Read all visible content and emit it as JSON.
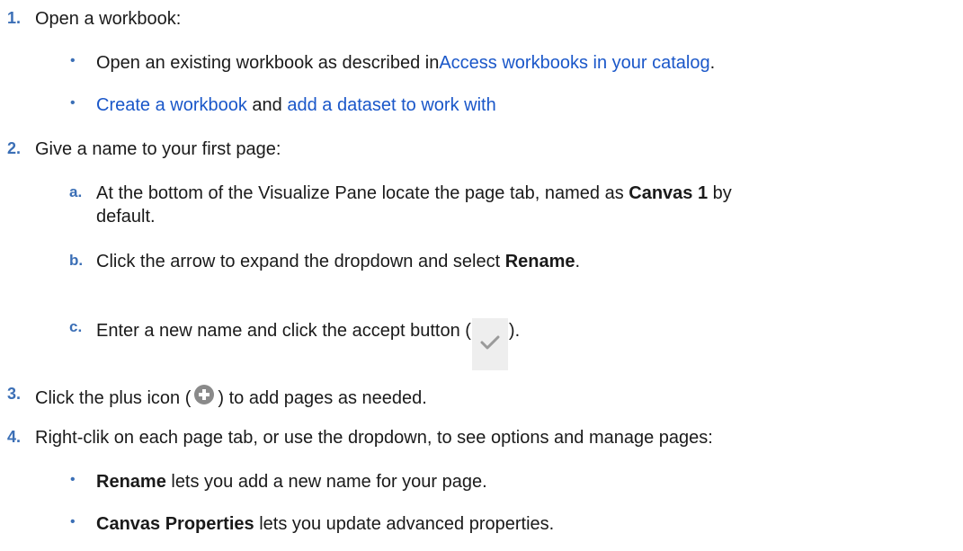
{
  "steps": [
    {
      "num": "1.",
      "text": "Open a workbook:",
      "bullets": [
        {
          "pre": "Open an existing workbook as described in",
          "link": "Access workbooks in your catalog",
          "post": "."
        },
        {
          "link1": "Create a workbook",
          "mid": " and ",
          "link2": "add a dataset to work with"
        }
      ]
    },
    {
      "num": "2.",
      "text": "Give a name to your first page:",
      "subs": [
        {
          "letter": "a.",
          "pre": "At the bottom of the Visualize Pane locate the page tab, named as ",
          "bold": "Canvas 1",
          "post": " by",
          "line2": "default."
        },
        {
          "letter": "b.",
          "pre": "Click the arrow to expand the dropdown and select ",
          "bold": "Rename",
          "post": "."
        },
        {
          "letter": "c.",
          "pre": "Enter a new name and click the accept button (",
          "post": ")."
        }
      ]
    },
    {
      "num": "3.",
      "pre": "Click the plus icon (",
      "post": ") to add pages as needed."
    },
    {
      "num": "4.",
      "text": "Right-clik on each page tab, or use the dropdown, to see options and manage pages:",
      "bullets": [
        {
          "bold": "Rename",
          "rest": " lets you add a new name for your page."
        },
        {
          "bold": "Canvas Properties",
          "rest": " lets you update advanced properties."
        }
      ]
    }
  ],
  "bullet_char": "•",
  "colors": {
    "accent": "#3b6fb6",
    "link": "#1a57c9",
    "icon_bg": "#eeeeee",
    "check": "#9a9a9a",
    "plus": "#8a8a8a"
  },
  "icons": {
    "accept": "checkmark-icon",
    "add": "plus-circle-icon"
  }
}
